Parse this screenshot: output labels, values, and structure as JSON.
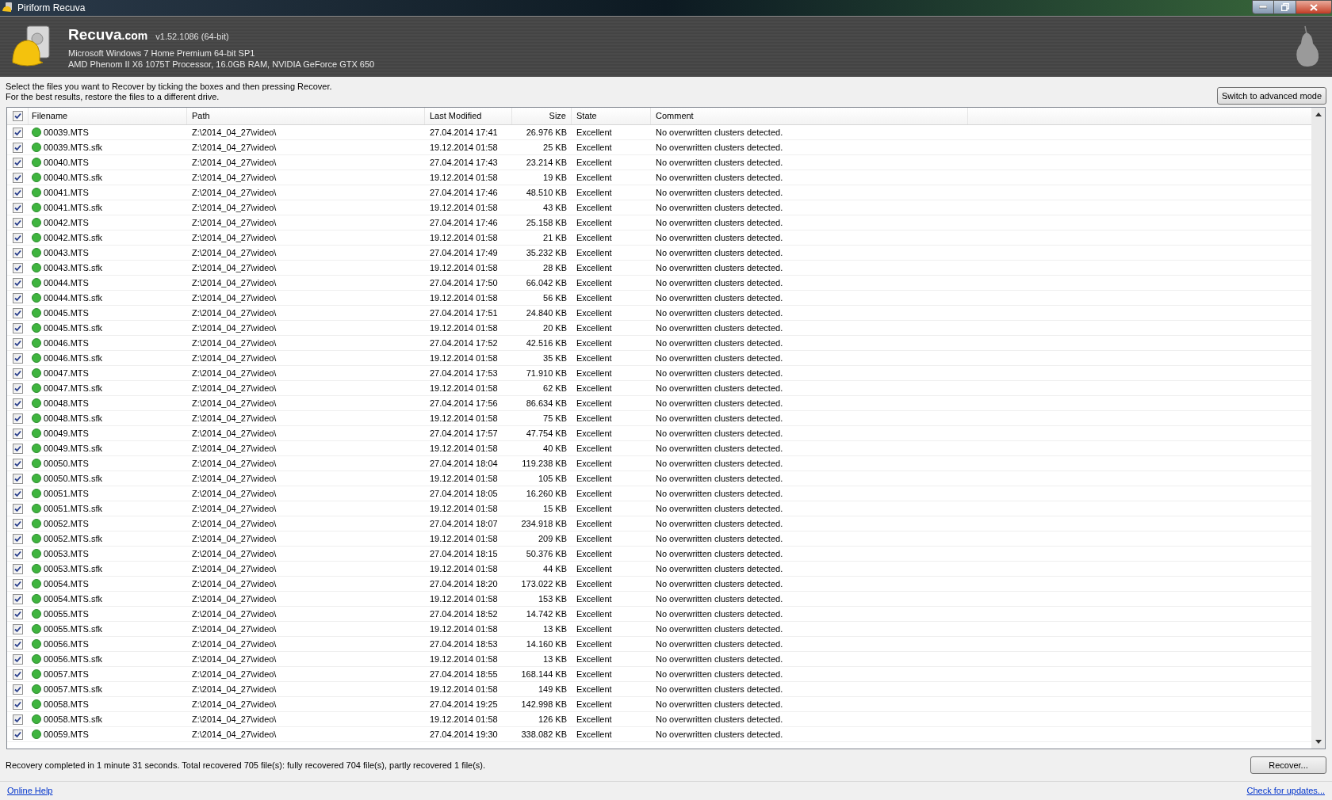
{
  "window": {
    "title": "Piriform Recuva"
  },
  "header": {
    "brand": "Recuva",
    "brand_suffix": ".com",
    "version": "v1.52.1086 (64-bit)",
    "os": "Microsoft Windows 7 Home Premium 64-bit SP1",
    "hardware": "AMD Phenom II X6 1075T Processor, 16.0GB RAM, NVIDIA GeForce GTX 650"
  },
  "instructions": [
    "Select the files you want to Recover by ticking the boxes and then pressing Recover.",
    "For the best results, restore the files to a different drive."
  ],
  "mode_button": "Switch to advanced mode",
  "table": {
    "all_checked": true,
    "columns": [
      "Filename",
      "Path",
      "Last Modified",
      "Size",
      "State",
      "Comment"
    ],
    "rows": [
      {
        "checked": true,
        "filename": "00039.MTS",
        "path": "Z:\\2014_04_27\\video\\",
        "modified": "27.04.2014 17:41",
        "size": "26.976 KB",
        "state": "Excellent",
        "comment": "No overwritten clusters detected."
      },
      {
        "checked": true,
        "filename": "00039.MTS.sfk",
        "path": "Z:\\2014_04_27\\video\\",
        "modified": "19.12.2014 01:58",
        "size": "25 KB",
        "state": "Excellent",
        "comment": "No overwritten clusters detected."
      },
      {
        "checked": true,
        "filename": "00040.MTS",
        "path": "Z:\\2014_04_27\\video\\",
        "modified": "27.04.2014 17:43",
        "size": "23.214 KB",
        "state": "Excellent",
        "comment": "No overwritten clusters detected."
      },
      {
        "checked": true,
        "filename": "00040.MTS.sfk",
        "path": "Z:\\2014_04_27\\video\\",
        "modified": "19.12.2014 01:58",
        "size": "19 KB",
        "state": "Excellent",
        "comment": "No overwritten clusters detected."
      },
      {
        "checked": true,
        "filename": "00041.MTS",
        "path": "Z:\\2014_04_27\\video\\",
        "modified": "27.04.2014 17:46",
        "size": "48.510 KB",
        "state": "Excellent",
        "comment": "No overwritten clusters detected."
      },
      {
        "checked": true,
        "filename": "00041.MTS.sfk",
        "path": "Z:\\2014_04_27\\video\\",
        "modified": "19.12.2014 01:58",
        "size": "43 KB",
        "state": "Excellent",
        "comment": "No overwritten clusters detected."
      },
      {
        "checked": true,
        "filename": "00042.MTS",
        "path": "Z:\\2014_04_27\\video\\",
        "modified": "27.04.2014 17:46",
        "size": "25.158 KB",
        "state": "Excellent",
        "comment": "No overwritten clusters detected."
      },
      {
        "checked": true,
        "filename": "00042.MTS.sfk",
        "path": "Z:\\2014_04_27\\video\\",
        "modified": "19.12.2014 01:58",
        "size": "21 KB",
        "state": "Excellent",
        "comment": "No overwritten clusters detected."
      },
      {
        "checked": true,
        "filename": "00043.MTS",
        "path": "Z:\\2014_04_27\\video\\",
        "modified": "27.04.2014 17:49",
        "size": "35.232 KB",
        "state": "Excellent",
        "comment": "No overwritten clusters detected."
      },
      {
        "checked": true,
        "filename": "00043.MTS.sfk",
        "path": "Z:\\2014_04_27\\video\\",
        "modified": "19.12.2014 01:58",
        "size": "28 KB",
        "state": "Excellent",
        "comment": "No overwritten clusters detected."
      },
      {
        "checked": true,
        "filename": "00044.MTS",
        "path": "Z:\\2014_04_27\\video\\",
        "modified": "27.04.2014 17:50",
        "size": "66.042 KB",
        "state": "Excellent",
        "comment": "No overwritten clusters detected."
      },
      {
        "checked": true,
        "filename": "00044.MTS.sfk",
        "path": "Z:\\2014_04_27\\video\\",
        "modified": "19.12.2014 01:58",
        "size": "56 KB",
        "state": "Excellent",
        "comment": "No overwritten clusters detected."
      },
      {
        "checked": true,
        "filename": "00045.MTS",
        "path": "Z:\\2014_04_27\\video\\",
        "modified": "27.04.2014 17:51",
        "size": "24.840 KB",
        "state": "Excellent",
        "comment": "No overwritten clusters detected."
      },
      {
        "checked": true,
        "filename": "00045.MTS.sfk",
        "path": "Z:\\2014_04_27\\video\\",
        "modified": "19.12.2014 01:58",
        "size": "20 KB",
        "state": "Excellent",
        "comment": "No overwritten clusters detected."
      },
      {
        "checked": true,
        "filename": "00046.MTS",
        "path": "Z:\\2014_04_27\\video\\",
        "modified": "27.04.2014 17:52",
        "size": "42.516 KB",
        "state": "Excellent",
        "comment": "No overwritten clusters detected."
      },
      {
        "checked": true,
        "filename": "00046.MTS.sfk",
        "path": "Z:\\2014_04_27\\video\\",
        "modified": "19.12.2014 01:58",
        "size": "35 KB",
        "state": "Excellent",
        "comment": "No overwritten clusters detected."
      },
      {
        "checked": true,
        "filename": "00047.MTS",
        "path": "Z:\\2014_04_27\\video\\",
        "modified": "27.04.2014 17:53",
        "size": "71.910 KB",
        "state": "Excellent",
        "comment": "No overwritten clusters detected."
      },
      {
        "checked": true,
        "filename": "00047.MTS.sfk",
        "path": "Z:\\2014_04_27\\video\\",
        "modified": "19.12.2014 01:58",
        "size": "62 KB",
        "state": "Excellent",
        "comment": "No overwritten clusters detected."
      },
      {
        "checked": true,
        "filename": "00048.MTS",
        "path": "Z:\\2014_04_27\\video\\",
        "modified": "27.04.2014 17:56",
        "size": "86.634 KB",
        "state": "Excellent",
        "comment": "No overwritten clusters detected."
      },
      {
        "checked": true,
        "filename": "00048.MTS.sfk",
        "path": "Z:\\2014_04_27\\video\\",
        "modified": "19.12.2014 01:58",
        "size": "75 KB",
        "state": "Excellent",
        "comment": "No overwritten clusters detected."
      },
      {
        "checked": true,
        "filename": "00049.MTS",
        "path": "Z:\\2014_04_27\\video\\",
        "modified": "27.04.2014 17:57",
        "size": "47.754 KB",
        "state": "Excellent",
        "comment": "No overwritten clusters detected."
      },
      {
        "checked": true,
        "filename": "00049.MTS.sfk",
        "path": "Z:\\2014_04_27\\video\\",
        "modified": "19.12.2014 01:58",
        "size": "40 KB",
        "state": "Excellent",
        "comment": "No overwritten clusters detected."
      },
      {
        "checked": true,
        "filename": "00050.MTS",
        "path": "Z:\\2014_04_27\\video\\",
        "modified": "27.04.2014 18:04",
        "size": "119.238 KB",
        "state": "Excellent",
        "comment": "No overwritten clusters detected."
      },
      {
        "checked": true,
        "filename": "00050.MTS.sfk",
        "path": "Z:\\2014_04_27\\video\\",
        "modified": "19.12.2014 01:58",
        "size": "105 KB",
        "state": "Excellent",
        "comment": "No overwritten clusters detected."
      },
      {
        "checked": true,
        "filename": "00051.MTS",
        "path": "Z:\\2014_04_27\\video\\",
        "modified": "27.04.2014 18:05",
        "size": "16.260 KB",
        "state": "Excellent",
        "comment": "No overwritten clusters detected."
      },
      {
        "checked": true,
        "filename": "00051.MTS.sfk",
        "path": "Z:\\2014_04_27\\video\\",
        "modified": "19.12.2014 01:58",
        "size": "15 KB",
        "state": "Excellent",
        "comment": "No overwritten clusters detected."
      },
      {
        "checked": true,
        "filename": "00052.MTS",
        "path": "Z:\\2014_04_27\\video\\",
        "modified": "27.04.2014 18:07",
        "size": "234.918 KB",
        "state": "Excellent",
        "comment": "No overwritten clusters detected."
      },
      {
        "checked": true,
        "filename": "00052.MTS.sfk",
        "path": "Z:\\2014_04_27\\video\\",
        "modified": "19.12.2014 01:58",
        "size": "209 KB",
        "state": "Excellent",
        "comment": "No overwritten clusters detected."
      },
      {
        "checked": true,
        "filename": "00053.MTS",
        "path": "Z:\\2014_04_27\\video\\",
        "modified": "27.04.2014 18:15",
        "size": "50.376 KB",
        "state": "Excellent",
        "comment": "No overwritten clusters detected."
      },
      {
        "checked": true,
        "filename": "00053.MTS.sfk",
        "path": "Z:\\2014_04_27\\video\\",
        "modified": "19.12.2014 01:58",
        "size": "44 KB",
        "state": "Excellent",
        "comment": "No overwritten clusters detected."
      },
      {
        "checked": true,
        "filename": "00054.MTS",
        "path": "Z:\\2014_04_27\\video\\",
        "modified": "27.04.2014 18:20",
        "size": "173.022 KB",
        "state": "Excellent",
        "comment": "No overwritten clusters detected."
      },
      {
        "checked": true,
        "filename": "00054.MTS.sfk",
        "path": "Z:\\2014_04_27\\video\\",
        "modified": "19.12.2014 01:58",
        "size": "153 KB",
        "state": "Excellent",
        "comment": "No overwritten clusters detected."
      },
      {
        "checked": true,
        "filename": "00055.MTS",
        "path": "Z:\\2014_04_27\\video\\",
        "modified": "27.04.2014 18:52",
        "size": "14.742 KB",
        "state": "Excellent",
        "comment": "No overwritten clusters detected."
      },
      {
        "checked": true,
        "filename": "00055.MTS.sfk",
        "path": "Z:\\2014_04_27\\video\\",
        "modified": "19.12.2014 01:58",
        "size": "13 KB",
        "state": "Excellent",
        "comment": "No overwritten clusters detected."
      },
      {
        "checked": true,
        "filename": "00056.MTS",
        "path": "Z:\\2014_04_27\\video\\",
        "modified": "27.04.2014 18:53",
        "size": "14.160 KB",
        "state": "Excellent",
        "comment": "No overwritten clusters detected."
      },
      {
        "checked": true,
        "filename": "00056.MTS.sfk",
        "path": "Z:\\2014_04_27\\video\\",
        "modified": "19.12.2014 01:58",
        "size": "13 KB",
        "state": "Excellent",
        "comment": "No overwritten clusters detected."
      },
      {
        "checked": true,
        "filename": "00057.MTS",
        "path": "Z:\\2014_04_27\\video\\",
        "modified": "27.04.2014 18:55",
        "size": "168.144 KB",
        "state": "Excellent",
        "comment": "No overwritten clusters detected."
      },
      {
        "checked": true,
        "filename": "00057.MTS.sfk",
        "path": "Z:\\2014_04_27\\video\\",
        "modified": "19.12.2014 01:58",
        "size": "149 KB",
        "state": "Excellent",
        "comment": "No overwritten clusters detected."
      },
      {
        "checked": true,
        "filename": "00058.MTS",
        "path": "Z:\\2014_04_27\\video\\",
        "modified": "27.04.2014 19:25",
        "size": "142.998 KB",
        "state": "Excellent",
        "comment": "No overwritten clusters detected."
      },
      {
        "checked": true,
        "filename": "00058.MTS.sfk",
        "path": "Z:\\2014_04_27\\video\\",
        "modified": "19.12.2014 01:58",
        "size": "126 KB",
        "state": "Excellent",
        "comment": "No overwritten clusters detected."
      },
      {
        "checked": true,
        "filename": "00059.MTS",
        "path": "Z:\\2014_04_27\\video\\",
        "modified": "27.04.2014 19:30",
        "size": "338.082 KB",
        "state": "Excellent",
        "comment": "No overwritten clusters detected."
      }
    ]
  },
  "status": "Recovery completed in 1 minute 31 seconds. Total recovered 705 file(s): fully recovered 704 file(s), partly recovered 1 file(s).",
  "recover_button": "Recover...",
  "footer": {
    "help_link": "Online Help",
    "update_link": "Check for updates..."
  }
}
